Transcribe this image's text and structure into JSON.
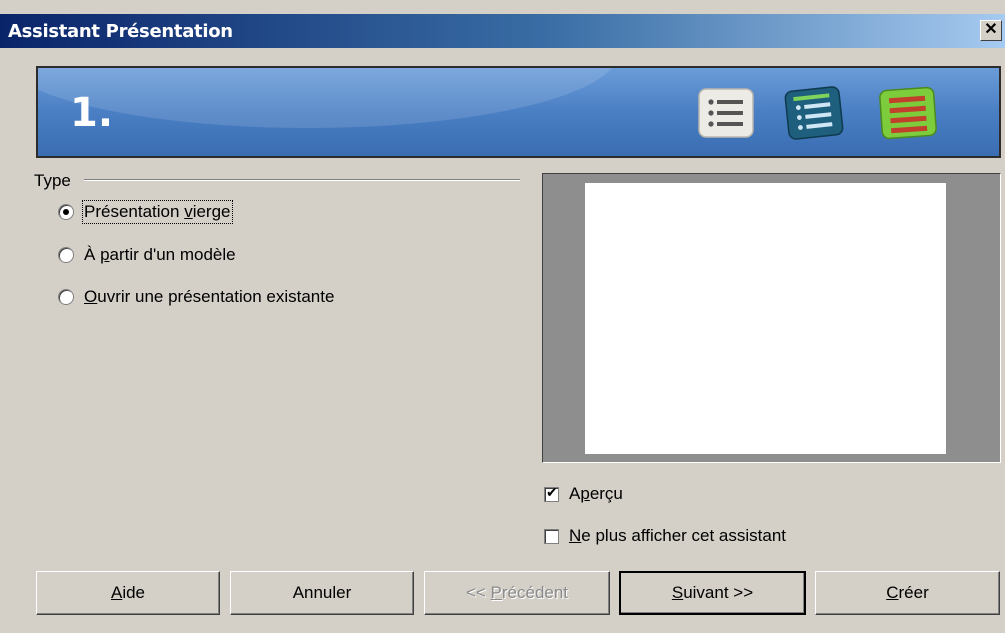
{
  "window": {
    "title": "Assistant Présentation",
    "close_glyph": "✕"
  },
  "banner": {
    "step": "1.",
    "icons": [
      "list-icon",
      "list-blue-icon",
      "list-green-icon"
    ]
  },
  "type_group": {
    "label": "Type",
    "options": [
      {
        "pre": "Présentation ",
        "mn": "v",
        "post": "ierge",
        "checked": true
      },
      {
        "pre": "À ",
        "mn": "p",
        "post": "artir d'un modèle",
        "checked": false
      },
      {
        "pre": "",
        "mn": "O",
        "post": "uvrir une présentation existante",
        "checked": false
      }
    ]
  },
  "preview_opt": {
    "pre": "A",
    "mn": "p",
    "post": "erçu",
    "checked": true
  },
  "no_show_opt": {
    "pre": "",
    "mn": "N",
    "post": "e plus afficher cet assistant",
    "checked": false
  },
  "buttons": {
    "help": {
      "pre": "",
      "mn": "A",
      "post": "ide"
    },
    "cancel": {
      "label": "Annuler"
    },
    "back": {
      "pre": "<< ",
      "mn": "P",
      "post": "récédent"
    },
    "next": {
      "pre": "",
      "mn": "S",
      "post": "uivant >>"
    },
    "create": {
      "pre": "",
      "mn": "C",
      "post": "réer"
    }
  }
}
